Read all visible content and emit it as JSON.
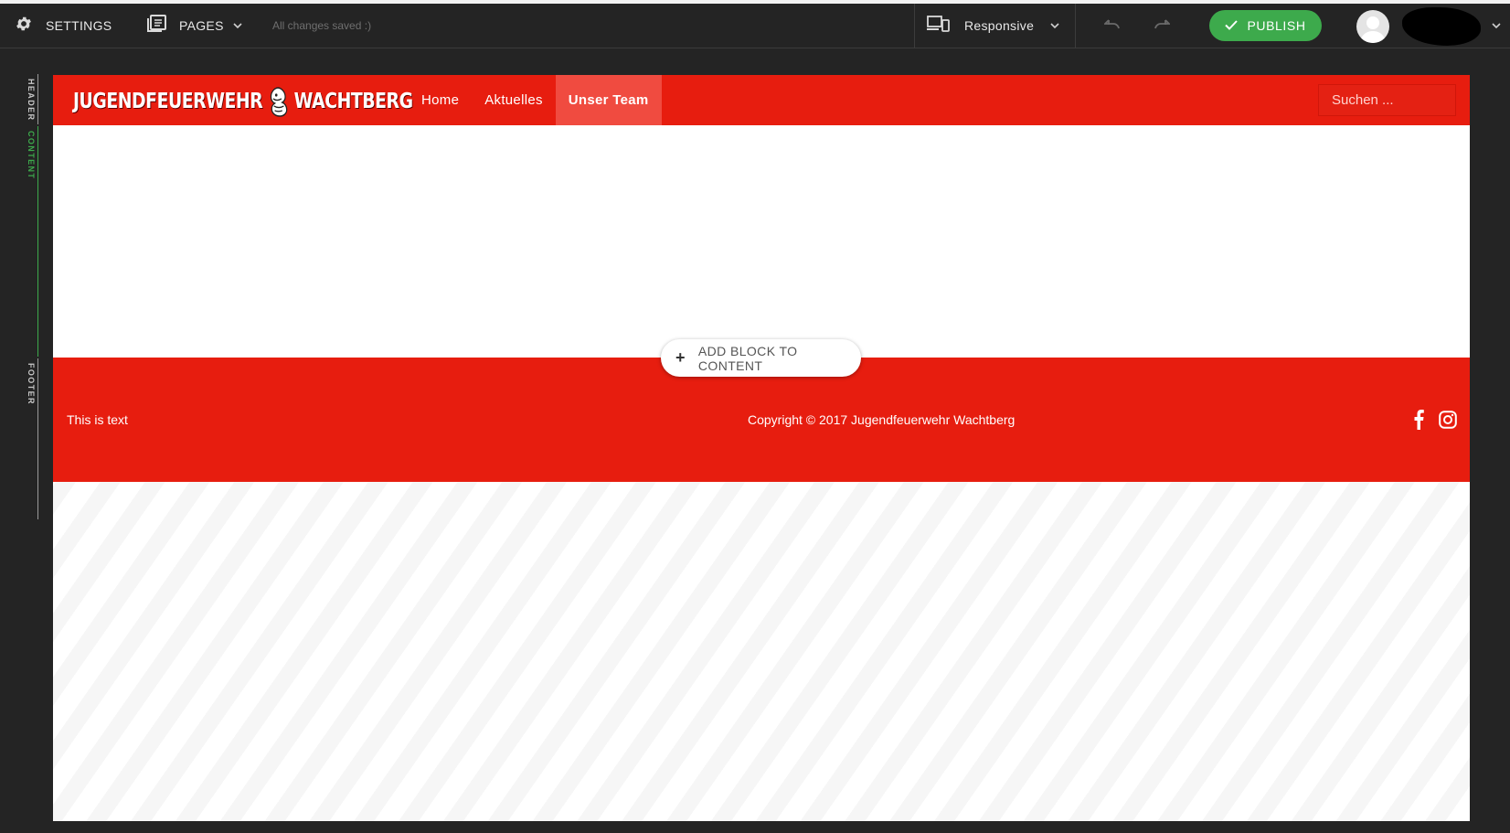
{
  "toolbar": {
    "settings_label": "SETTINGS",
    "pages_label": "PAGES",
    "save_status": "All changes saved :)",
    "device_label": "Responsive",
    "publish_label": "PUBLISH"
  },
  "sections_rail": {
    "header": "HEADER",
    "content": "CONTENT",
    "footer": "FOOTER"
  },
  "site": {
    "logo_left": "JUGENDFEUERWEHR",
    "logo_right": "WACHTBERG",
    "nav": [
      "Home",
      "Aktuelles",
      "Unser Team"
    ],
    "active_nav": "Unser Team",
    "search_placeholder": "Suchen ...",
    "add_block_label": "ADD BLOCK TO CONTENT",
    "footer_text": "This is text",
    "copyright": "Copyright © 2017 Jugendfeuerwehr Wachtberg"
  },
  "colors": {
    "brand_red": "#e71d0f",
    "active_nav": "#f04b40",
    "publish_green": "#3daa4c",
    "toolbar_bg": "#242424"
  },
  "icons": [
    "gear-icon",
    "pages-icon",
    "chevron-down-icon",
    "devices-icon",
    "undo-icon",
    "redo-icon",
    "check-icon",
    "user-avatar-icon",
    "plus-icon",
    "facebook-icon",
    "instagram-icon"
  ]
}
